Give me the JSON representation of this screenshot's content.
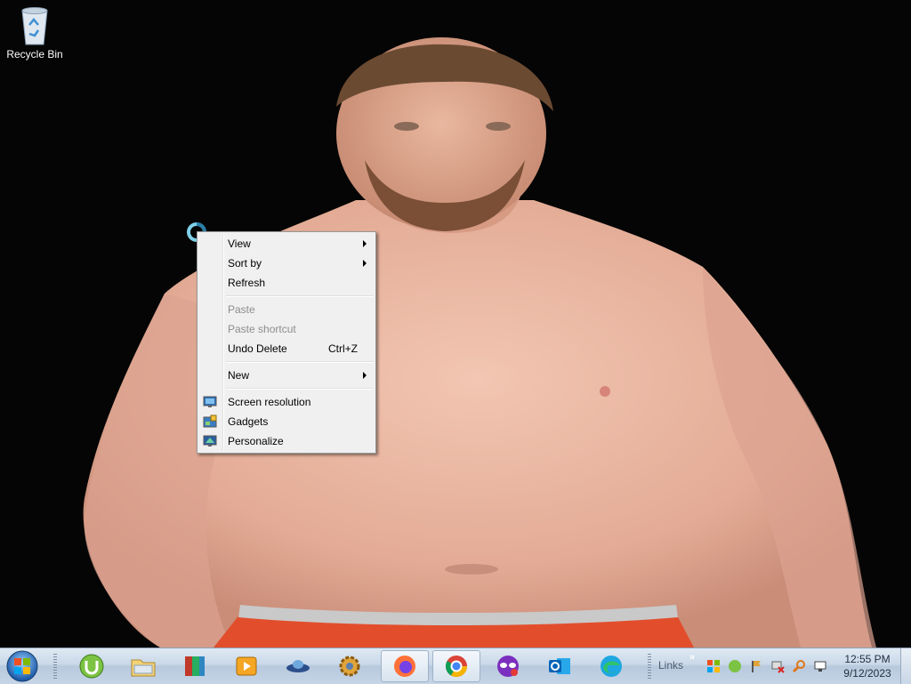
{
  "desktop": {
    "icons": [
      {
        "label": "Recycle Bin",
        "icon": "recycle-bin-icon"
      }
    ]
  },
  "context_menu": {
    "items": [
      {
        "label": "View",
        "submenu": true
      },
      {
        "label": "Sort by",
        "submenu": true
      },
      {
        "label": "Refresh"
      },
      {
        "label": "Paste",
        "disabled": true
      },
      {
        "label": "Paste shortcut",
        "disabled": true
      },
      {
        "label": "Undo Delete",
        "shortcut": "Ctrl+Z"
      },
      {
        "label": "New",
        "submenu": true
      },
      {
        "label": "Screen resolution",
        "icon": "monitor-icon"
      },
      {
        "label": "Gadgets",
        "icon": "gadgets-icon"
      },
      {
        "label": "Personalize",
        "icon": "personalize-icon"
      }
    ]
  },
  "taskbar": {
    "pinned": [
      {
        "name": "utorrent",
        "icon": "utorrent-icon"
      },
      {
        "name": "file-explorer",
        "icon": "folder-icon"
      },
      {
        "name": "winrar",
        "icon": "winrar-icon"
      },
      {
        "name": "media-player",
        "icon": "media-player-icon"
      },
      {
        "name": "ufo-app",
        "icon": "ufo-icon"
      },
      {
        "name": "gear-app",
        "icon": "gear-app-icon"
      },
      {
        "name": "firefox",
        "icon": "firefox-icon",
        "active": true
      },
      {
        "name": "chrome",
        "icon": "chrome-icon",
        "active": true
      },
      {
        "name": "masked-app",
        "icon": "mask-icon"
      },
      {
        "name": "outlook",
        "icon": "outlook-icon"
      },
      {
        "name": "edge",
        "icon": "edge-icon"
      }
    ],
    "links_label": "Links",
    "links_chevron": "»",
    "tray_icons": [
      "windows-flag-icon",
      "utorrent-tray-icon",
      "flag-tray-icon",
      "network-error-icon",
      "search-tray-icon",
      "display-tray-icon"
    ],
    "clock": {
      "time": "12:55 PM",
      "date": "9/12/2023"
    }
  },
  "colors": {
    "menu_bg": "#f0f0f0",
    "menu_disabled": "#8d8d8d",
    "taskbar_top": "#dfe9f3",
    "taskbar_bottom": "#c5d5e6"
  }
}
